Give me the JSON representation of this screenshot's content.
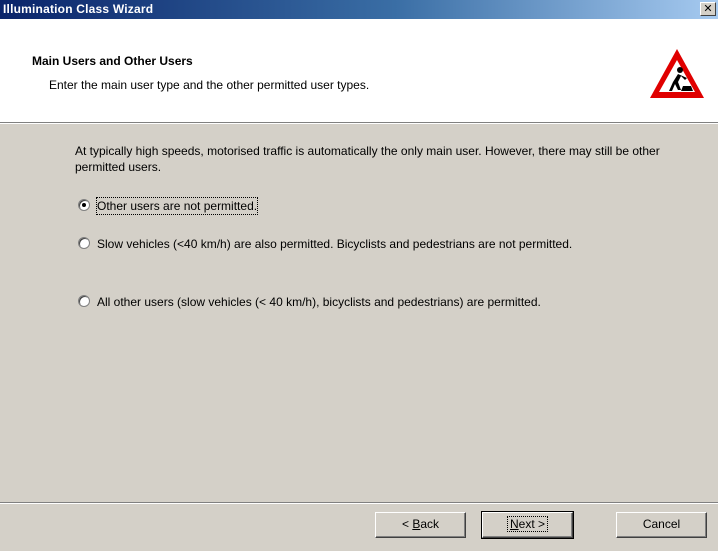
{
  "window": {
    "title": "Illumination Class Wizard",
    "close_label": "✕"
  },
  "header": {
    "title": "Main Users and Other Users",
    "subtitle": "Enter the main user type and the other permitted user types.",
    "icon": "roadworks-warning-icon"
  },
  "body": {
    "intro": "At typically high speeds, motorised traffic is automatically the only main user. However, there may still be other permitted users.",
    "options": [
      {
        "label": "Other users are not permitted.",
        "checked": true
      },
      {
        "label": "Slow vehicles (<40 km/h) are also permitted. Bicyclists and pedestrians are not permitted.",
        "checked": false
      },
      {
        "label": "All other users (slow vehicles (< 40 km/h), bicyclists and pedestrians) are permitted.",
        "checked": false
      }
    ]
  },
  "buttons": {
    "back_prefix": "< ",
    "back_key": "B",
    "back_rest": "ack",
    "next_key": "N",
    "next_rest": "ext >",
    "cancel": "Cancel"
  }
}
